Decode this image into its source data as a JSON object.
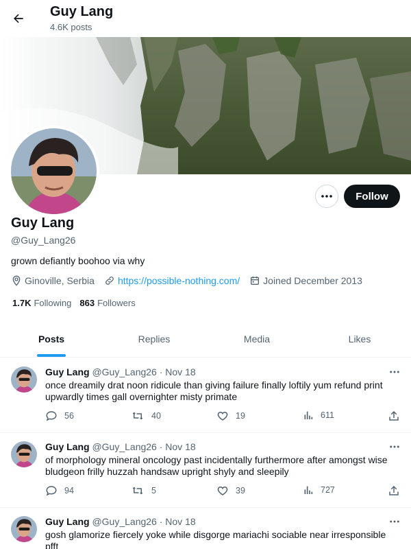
{
  "header": {
    "name": "Guy Lang",
    "post_count": "4.6K posts"
  },
  "profile": {
    "name": "Guy Lang",
    "handle": "@Guy_Lang26",
    "bio": "grown defiantly boohoo via why",
    "location": "Ginoville, Serbia",
    "website": "https://possible-nothing.com/",
    "joined": "Joined December 2013",
    "following_count": "1.7K",
    "following_label": "Following",
    "followers_count": "863",
    "followers_label": "Followers",
    "follow_button": "Follow"
  },
  "tabs": [
    {
      "label": "Posts",
      "active": true
    },
    {
      "label": "Replies",
      "active": false
    },
    {
      "label": "Media",
      "active": false
    },
    {
      "label": "Likes",
      "active": false
    }
  ],
  "tweets": [
    {
      "name": "Guy Lang",
      "handle": "@Guy_Lang26",
      "date": "· Nov 18",
      "text": "once dreamily drat noon ridicule than giving failure finally loftily yum refund print upwardly times gall overnighter misty primate",
      "replies": "56",
      "retweets": "40",
      "likes": "19",
      "views": "611"
    },
    {
      "name": "Guy Lang",
      "handle": "@Guy_Lang26",
      "date": "· Nov 18",
      "text": "of morphology mineral oncology past incidentally furthermore after amongst wise bludgeon frilly huzzah handsaw upright shyly and sleepily",
      "replies": "94",
      "retweets": "5",
      "likes": "39",
      "views": "727"
    },
    {
      "name": "Guy Lang",
      "handle": "@Guy_Lang26",
      "date": "· Nov 18",
      "text": "gosh glamorize fiercely yoke while disgorge mariachi sociable near irresponsible pfft",
      "replies": "",
      "retweets": "",
      "likes": "",
      "views": ""
    }
  ],
  "colors": {
    "accent": "#1d9bf0",
    "text": "#0f1419",
    "muted": "#536471",
    "button": "#0f1419"
  },
  "icons": [
    "back-arrow-icon",
    "location-pin-icon",
    "link-icon",
    "calendar-icon",
    "more-icon",
    "reply-icon",
    "retweet-icon",
    "like-icon",
    "views-icon",
    "share-icon"
  ]
}
